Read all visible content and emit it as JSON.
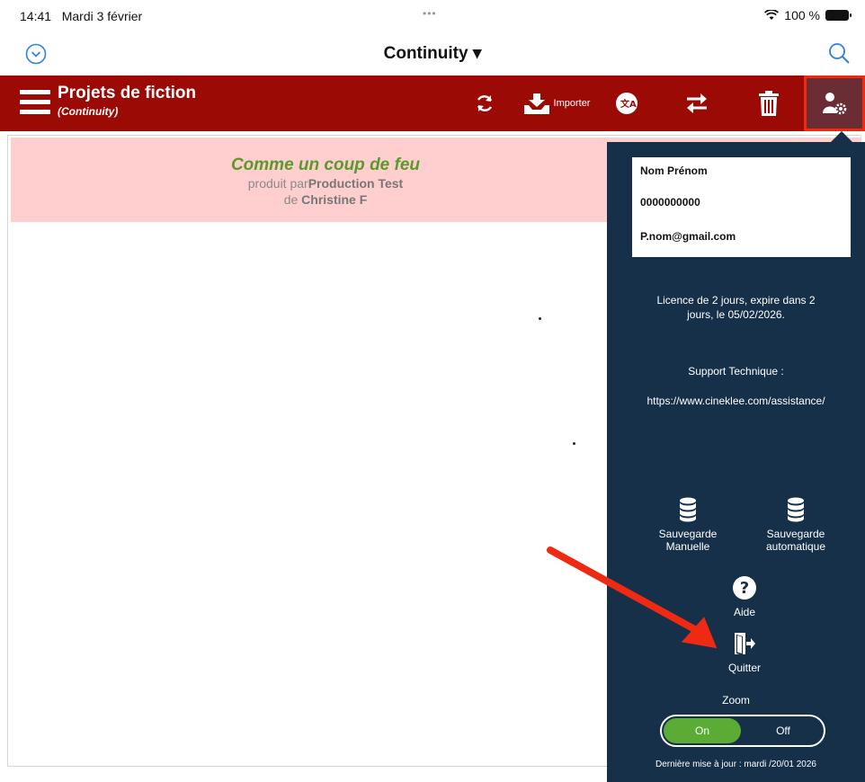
{
  "status_bar": {
    "time": "14:41",
    "date": "Mardi 3 février",
    "dots": "•••",
    "battery": "100 %"
  },
  "nav": {
    "title": "Continuity ▾"
  },
  "toolbar": {
    "title": "Projets de fiction",
    "subtitle": "(Continuity)",
    "import_label": "Importer"
  },
  "project": {
    "title": "Comme un coup de feu",
    "produced_prefix": "produit par",
    "producer": "Production Test",
    "author_prefix": "de ",
    "author": "Christine F"
  },
  "panel": {
    "user_name": "Nom Prénom",
    "phone": "0000000000",
    "email": "P.nom@gmail.com",
    "license_line1": "Licence de 2 jours, expire dans 2",
    "license_line2": "jours, le 05/02/2026.",
    "support_title": "Support Technique :",
    "support_url": "https://www.cineklee.com/assistance/",
    "backup_manual_line1": "Sauvegarde",
    "backup_manual_line2": "Manuelle",
    "backup_auto_line1": "Sauvegarde",
    "backup_auto_line2": "automatique",
    "help_label": "Aide",
    "quit_label": "Quitter",
    "zoom_label": "Zoom",
    "zoom_on": "On",
    "zoom_off": "Off",
    "last_update": "Dernière mise à jour : mardi /20/01 2026"
  },
  "colors": {
    "toolbar_red": "#9c0a05",
    "panel_navy": "#16304a",
    "banner_pink": "#ffcfcf",
    "title_green": "#5a9a2a",
    "toggle_green": "#5aac35",
    "annotation_red": "#ee2a12"
  },
  "icons": [
    "chevron-down-circle-icon",
    "search-icon",
    "hamburger-menu-icon",
    "sync-icon",
    "import-icon",
    "translate-icon",
    "swap-icon",
    "trash-icon",
    "user-settings-icon",
    "database-icon",
    "help-icon",
    "exit-icon",
    "wifi-icon",
    "battery-icon"
  ]
}
